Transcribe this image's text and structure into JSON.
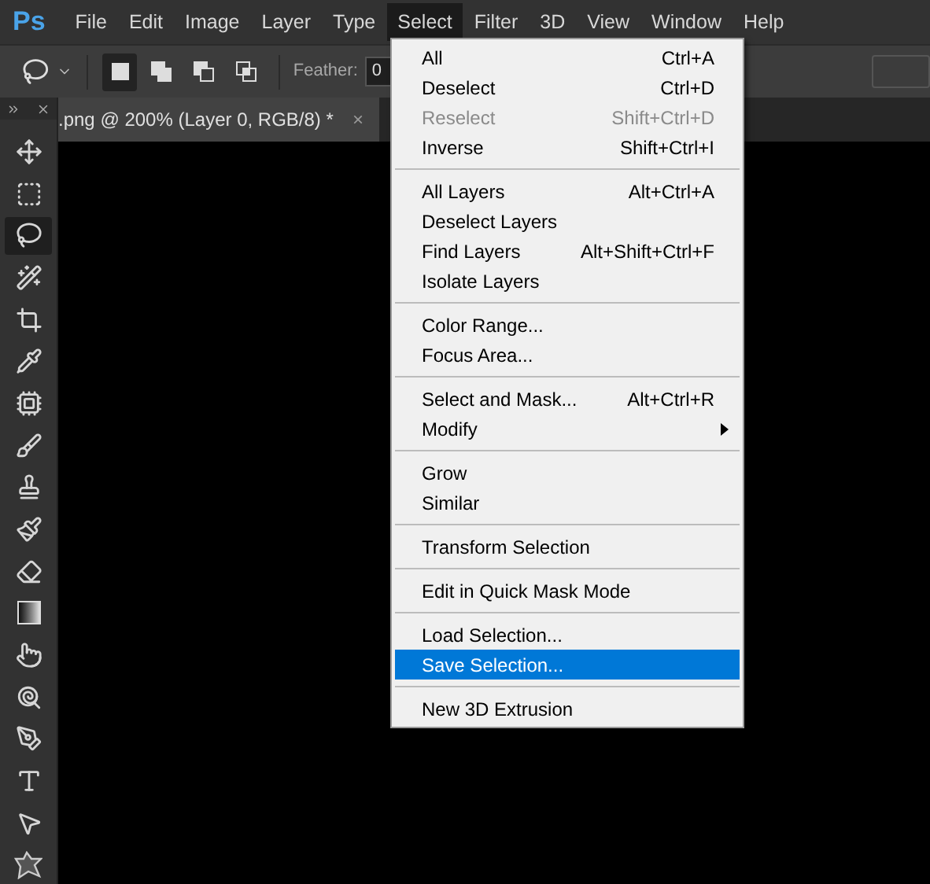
{
  "app": {
    "logo": "Ps"
  },
  "menubar": [
    {
      "label": "File",
      "selected": false
    },
    {
      "label": "Edit",
      "selected": false
    },
    {
      "label": "Image",
      "selected": false
    },
    {
      "label": "Layer",
      "selected": false
    },
    {
      "label": "Type",
      "selected": false
    },
    {
      "label": "Select",
      "selected": true
    },
    {
      "label": "Filter",
      "selected": false
    },
    {
      "label": "3D",
      "selected": false
    },
    {
      "label": "View",
      "selected": false
    },
    {
      "label": "Window",
      "selected": false
    },
    {
      "label": "Help",
      "selected": false
    }
  ],
  "options_bar": {
    "modes": [
      {
        "kind": "new",
        "selected": true
      },
      {
        "kind": "add",
        "selected": false
      },
      {
        "kind": "subtract",
        "selected": false
      },
      {
        "kind": "intersect",
        "selected": false
      }
    ],
    "feather_label": "Feather:",
    "feather_value": "0"
  },
  "document_tab": {
    "title": ".png @ 200% (Layer 0, RGB/8) *",
    "close": "×"
  },
  "tools": [
    {
      "kind": "move",
      "selected": false
    },
    {
      "kind": "marquee",
      "selected": false
    },
    {
      "kind": "lasso",
      "selected": true
    },
    {
      "kind": "wand",
      "selected": false
    },
    {
      "kind": "crop",
      "selected": false
    },
    {
      "kind": "eyedropper",
      "selected": false
    },
    {
      "kind": "healing",
      "selected": false
    },
    {
      "kind": "brush",
      "selected": false
    },
    {
      "kind": "stamp",
      "selected": false
    },
    {
      "kind": "history",
      "selected": false
    },
    {
      "kind": "eraser",
      "selected": false
    },
    {
      "kind": "gradient",
      "selected": false
    },
    {
      "kind": "smudge",
      "selected": false
    },
    {
      "kind": "dodge",
      "selected": false
    },
    {
      "kind": "pen",
      "selected": false
    },
    {
      "kind": "type",
      "selected": false
    },
    {
      "kind": "path",
      "selected": false
    },
    {
      "kind": "shape",
      "selected": false
    }
  ],
  "select_menu": [
    {
      "kind": "item",
      "label": "All",
      "shortcut": "Ctrl+A",
      "disabled": false,
      "selected": false
    },
    {
      "kind": "item",
      "label": "Deselect",
      "shortcut": "Ctrl+D",
      "disabled": false,
      "selected": false
    },
    {
      "kind": "item",
      "label": "Reselect",
      "shortcut": "Shift+Ctrl+D",
      "disabled": true,
      "selected": false
    },
    {
      "kind": "item",
      "label": "Inverse",
      "shortcut": "Shift+Ctrl+I",
      "disabled": false,
      "selected": false
    },
    {
      "kind": "separator"
    },
    {
      "kind": "item",
      "label": "All Layers",
      "shortcut": "Alt+Ctrl+A",
      "disabled": false,
      "selected": false
    },
    {
      "kind": "item",
      "label": "Deselect Layers",
      "disabled": false,
      "selected": false
    },
    {
      "kind": "item",
      "label": "Find Layers",
      "shortcut": "Alt+Shift+Ctrl+F",
      "disabled": false,
      "selected": false
    },
    {
      "kind": "item",
      "label": "Isolate Layers",
      "disabled": false,
      "selected": false
    },
    {
      "kind": "separator"
    },
    {
      "kind": "item",
      "label": "Color Range...",
      "disabled": false,
      "selected": false
    },
    {
      "kind": "item",
      "label": "Focus Area...",
      "disabled": false,
      "selected": false
    },
    {
      "kind": "separator"
    },
    {
      "kind": "item",
      "label": "Select and Mask...",
      "shortcut": "Alt+Ctrl+R",
      "disabled": false,
      "selected": false
    },
    {
      "kind": "submenu",
      "label": "Modify",
      "disabled": false,
      "selected": false
    },
    {
      "kind": "separator"
    },
    {
      "kind": "item",
      "label": "Grow",
      "disabled": false,
      "selected": false
    },
    {
      "kind": "item",
      "label": "Similar",
      "disabled": false,
      "selected": false
    },
    {
      "kind": "separator"
    },
    {
      "kind": "item",
      "label": "Transform Selection",
      "disabled": false,
      "selected": false
    },
    {
      "kind": "separator"
    },
    {
      "kind": "item",
      "label": "Edit in Quick Mask Mode",
      "disabled": false,
      "selected": false
    },
    {
      "kind": "separator"
    },
    {
      "kind": "item",
      "label": "Load Selection...",
      "disabled": false,
      "selected": false
    },
    {
      "kind": "item",
      "label": "Save Selection...",
      "disabled": false,
      "selected": true
    },
    {
      "kind": "separator"
    },
    {
      "kind": "item",
      "label": "New 3D Extrusion",
      "disabled": false,
      "selected": false
    }
  ]
}
